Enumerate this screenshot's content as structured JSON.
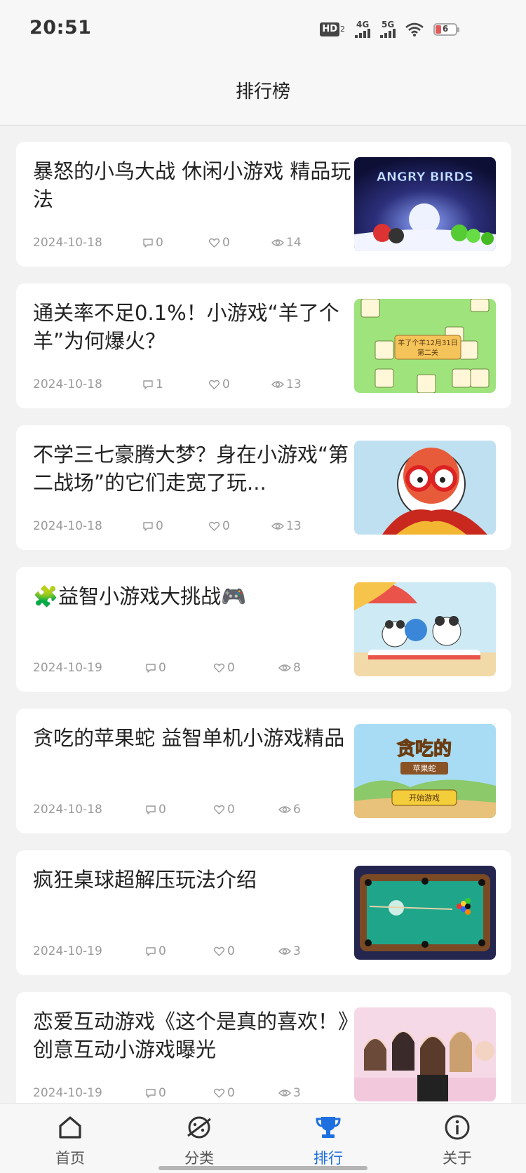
{
  "status_bar": {
    "time": "20:51",
    "hd_label": "HD",
    "hd_sub": "2",
    "net1": "4G",
    "net2": "5G",
    "battery": "6"
  },
  "header": {
    "title": "排行榜"
  },
  "articles": [
    {
      "title": "暴怒的小鸟大战 休闲小游戏 精品玩法",
      "date": "2024-10-18",
      "comments": "0",
      "likes": "0",
      "views": "14",
      "thumb_text": "ANGRY BIRDS",
      "thumb_icon": "angry-birds-thumbnail"
    },
    {
      "title": "通关率不足0.1%！小游戏“羊了个羊”为何爆火？",
      "date": "2024-10-18",
      "comments": "1",
      "likes": "0",
      "views": "13",
      "thumb_text": "羊了个羊12月31日",
      "thumb_sub": "第二关",
      "thumb_icon": "sheep-game-thumbnail"
    },
    {
      "title": "不学三七豪腾大梦？身在小游戏“第二战场”的它们走宽了玩...",
      "date": "2024-10-18",
      "comments": "0",
      "likes": "0",
      "views": "13",
      "thumb_icon": "monkey-character-thumbnail"
    },
    {
      "title": "🧩益智小游戏大挑战🎮",
      "date": "2024-10-19",
      "comments": "0",
      "likes": "0",
      "views": "8",
      "thumb_icon": "panda-beach-thumbnail"
    },
    {
      "title": "贪吃的苹果蛇 益智单机小游戏精品",
      "date": "2024-10-18",
      "comments": "0",
      "likes": "0",
      "views": "6",
      "thumb_text": "贪吃的",
      "thumb_sub": "苹果蛇",
      "thumb_btn": "开始游戏",
      "thumb_icon": "apple-snake-thumbnail"
    },
    {
      "title": "疯狂桌球超解压玩法介绍",
      "date": "2024-10-19",
      "comments": "0",
      "likes": "0",
      "views": "3",
      "thumb_icon": "billiards-table-thumbnail"
    },
    {
      "title": "恋爱互动游戏《这个是真的喜欢！》创意互动小游戏曝光",
      "date": "2024-10-19",
      "comments": "0",
      "likes": "0",
      "views": "3",
      "thumb_icon": "romance-game-thumbnail"
    }
  ],
  "nav": {
    "items": [
      {
        "label": "首页",
        "icon": "home-icon"
      },
      {
        "label": "分类",
        "icon": "planet-icon"
      },
      {
        "label": "排行",
        "icon": "trophy-icon"
      },
      {
        "label": "关于",
        "icon": "info-icon"
      }
    ],
    "active_color": "#1e6fe0",
    "inactive_color": "#444444"
  }
}
